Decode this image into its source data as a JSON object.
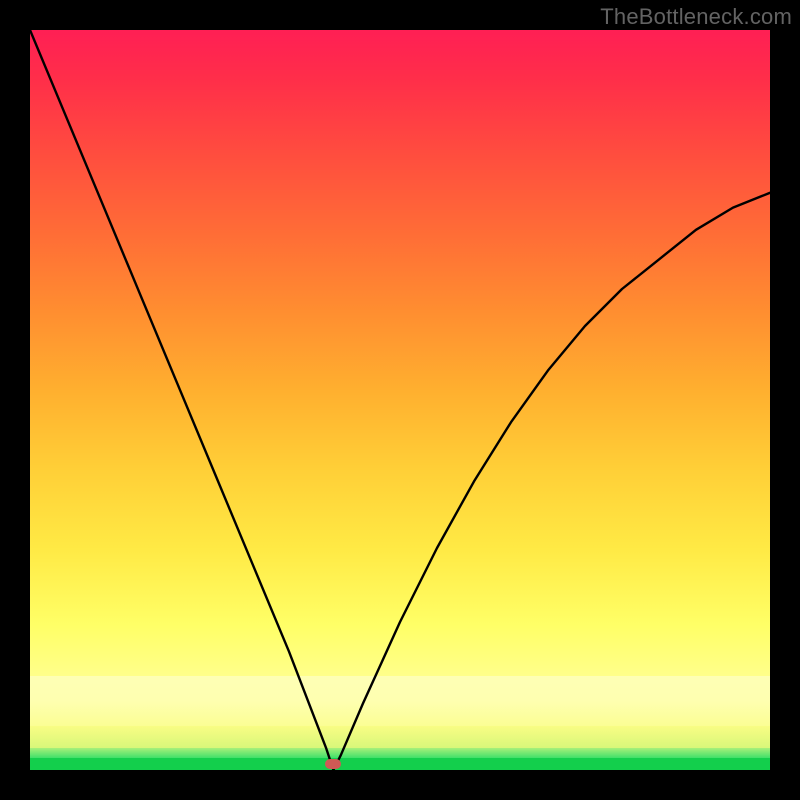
{
  "watermark": "TheBottleneck.com",
  "colors": {
    "frame_background": "#000000",
    "watermark_text": "#636363",
    "curve_stroke": "#000000",
    "marker_fill": "#cf5a55",
    "gradient_top": "#ff1f54",
    "gradient_mid": "#ffe944",
    "gradient_bottom_band": "#13cf4c"
  },
  "chart_data": {
    "type": "line",
    "title": "",
    "xlabel": "",
    "ylabel": "",
    "xlim": [
      0,
      100
    ],
    "ylim": [
      0,
      100
    ],
    "grid": false,
    "notes": "V-shaped bottleneck curve. y is bottleneck %, 0 at the optimum x≈41. Left branch rises near-linearly to ~100 at x=0. Right branch rises concavely toward ~78 at x=100. Background is a vertical color gradient mapping y to severity (green=good at bottom, red=bad at top).",
    "series": [
      {
        "name": "bottleneck-curve",
        "x": [
          0,
          5,
          10,
          15,
          20,
          25,
          30,
          35,
          40,
          41,
          42,
          45,
          50,
          55,
          60,
          65,
          70,
          75,
          80,
          85,
          90,
          95,
          100
        ],
        "y": [
          100,
          88,
          76,
          64,
          52,
          40,
          28,
          16,
          3,
          0,
          2,
          9,
          20,
          30,
          39,
          47,
          54,
          60,
          65,
          69,
          73,
          76,
          78
        ]
      }
    ],
    "optimum": {
      "x": 41,
      "y": 0
    },
    "marker": {
      "x": 41,
      "y": 0.8,
      "color": "#cf5a55"
    },
    "gradient_stops_y_to_color": [
      {
        "y": 0,
        "color": "#13cf4c"
      },
      {
        "y": 2,
        "color": "#a7f07a"
      },
      {
        "y": 5,
        "color": "#f9fd84"
      },
      {
        "y": 12,
        "color": "#feffb0"
      },
      {
        "y": 20,
        "color": "#ffff66"
      },
      {
        "y": 40,
        "color": "#ffcf37"
      },
      {
        "y": 60,
        "color": "#ff8f30"
      },
      {
        "y": 80,
        "color": "#ff4f3e"
      },
      {
        "y": 100,
        "color": "#ff1f54"
      }
    ]
  }
}
